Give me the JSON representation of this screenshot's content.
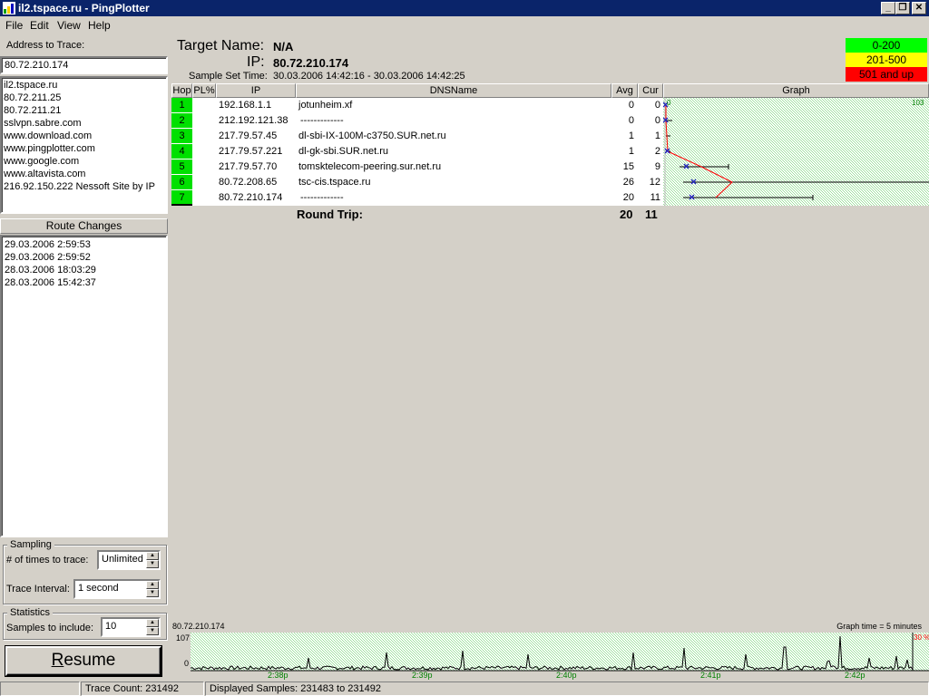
{
  "window": {
    "title": "il2.tspace.ru - PingPlotter"
  },
  "menu": {
    "items": [
      "File",
      "Edit",
      "View",
      "Help"
    ]
  },
  "sidebar": {
    "address_label": "Address to Trace:",
    "address_value": "80.72.210.174",
    "history": [
      "il2.tspace.ru",
      "80.72.211.25",
      "80.72.211.21",
      "sslvpn.sabre.com",
      "www.download.com",
      "www.pingplotter.com",
      "www.google.com",
      "www.altavista.com",
      "216.92.150.222 Nessoft Site by IP"
    ],
    "route_changes_label": "Route Changes",
    "route_changes": [
      "29.03.2006 2:59:53",
      "29.03.2006 2:59:52",
      "28.03.2006 18:03:29",
      "28.03.2006 15:42:37"
    ],
    "sampling": {
      "group_label": "Sampling",
      "times_label": "# of times to trace:",
      "times_value": "Unlimited",
      "interval_label": "Trace Interval:",
      "interval_value": "1 second"
    },
    "statistics": {
      "group_label": "Statistics",
      "samples_label": "Samples to include:",
      "samples_value": "10"
    },
    "resume_label": "Resume"
  },
  "target": {
    "name_label": "Target Name:",
    "name_value": "N/A",
    "ip_label": "IP:",
    "ip_value": "80.72.210.174",
    "sample_label": "Sample Set Time:",
    "sample_value": "30.03.2006 14:42:16 - 30.03.2006 14:42:25"
  },
  "legend": [
    {
      "label": "0-200",
      "color": "#00ff00",
      "text_color": "#000000"
    },
    {
      "label": "201-500",
      "color": "#ffff00",
      "text_color": "#000000"
    },
    {
      "label": "501 and up",
      "color": "#ff0000",
      "text_color": "#000000"
    }
  ],
  "table": {
    "headers": {
      "hop": "Hop",
      "pl": "PL%",
      "ip": "IP",
      "dns": "DNSName",
      "avg": "Avg",
      "cur": "Cur",
      "graph": "Graph"
    },
    "rows": [
      {
        "hop": "1",
        "ip": "192.168.1.1",
        "dns": "jotunheim.xf",
        "avg": "0",
        "cur": "0"
      },
      {
        "hop": "2",
        "ip": "212.192.121.38",
        "dns": "-------------",
        "avg": "0",
        "cur": "0"
      },
      {
        "hop": "3",
        "ip": "217.79.57.45",
        "dns": "dl-sbi-IX-100M-c3750.SUR.net.ru",
        "avg": "1",
        "cur": "1"
      },
      {
        "hop": "4",
        "ip": "217.79.57.221",
        "dns": "dl-gk-sbi.SUR.net.ru",
        "avg": "1",
        "cur": "2"
      },
      {
        "hop": "5",
        "ip": "217.79.57.70",
        "dns": "tomsktelecom-peering.sur.net.ru",
        "avg": "15",
        "cur": "9"
      },
      {
        "hop": "6",
        "ip": "80.72.208.65",
        "dns": "tsc-cis.tspace.ru",
        "avg": "26",
        "cur": "12"
      },
      {
        "hop": "7",
        "ip": "80.72.210.174",
        "dns": "-------------",
        "avg": "20",
        "cur": "11"
      }
    ],
    "round_trip": {
      "label": "Round Trip:",
      "avg": "20",
      "cur": "11"
    },
    "graph_min_label": "0",
    "graph_max_label": "103"
  },
  "timeline": {
    "host_label": "80.72.210.174",
    "graph_time": "Graph time = 5 minutes",
    "y_max_label": "107",
    "y_min_label": "0",
    "loss_label": "30 %",
    "ticks": [
      "2:38p",
      "2:39p",
      "2:40p",
      "2:41p",
      "2:42p"
    ]
  },
  "status": {
    "trace_count": "Trace Count: 231492",
    "displayed": "Displayed Samples: 231483 to 231492"
  }
}
